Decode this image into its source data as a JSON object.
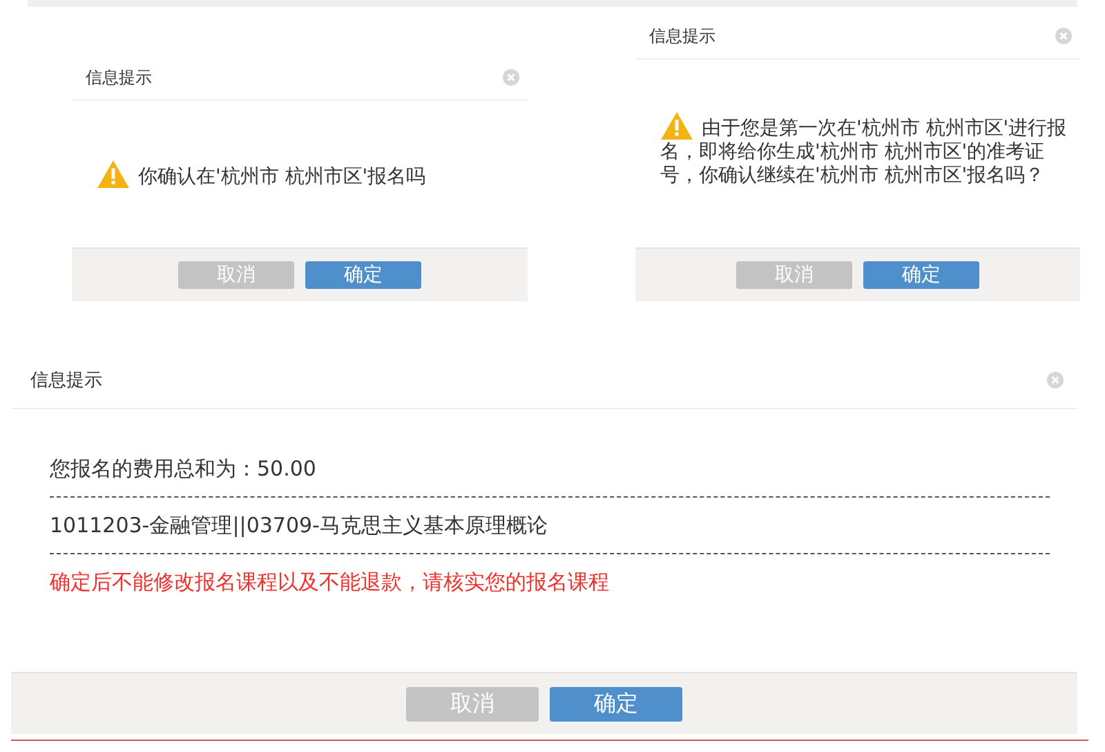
{
  "dialogs": [
    {
      "kind": "warning",
      "title": "信息提示",
      "message": "你确认在'杭州市 杭州市区'报名吗",
      "buttons": [
        {
          "kind": "cancel",
          "label": "取消"
        },
        {
          "kind": "confirm",
          "label": "确定"
        }
      ]
    },
    {
      "kind": "warning",
      "title": "信息提示",
      "message": "由于您是第一次在'杭州市 杭州市区'进行报名，即将给你生成'杭州市 杭州市区'的准考证号，你确认继续在'杭州市 杭州市区'报名吗？",
      "buttons": [
        {
          "kind": "cancel",
          "label": "取消"
        },
        {
          "kind": "confirm",
          "label": "确定"
        }
      ]
    },
    {
      "kind": "summary",
      "title": "信息提示",
      "lines": [
        {
          "kind": "plain",
          "text": "您报名的费用总和为：50.00"
        },
        {
          "kind": "plain",
          "text": "1011203-金融管理||03709-马克思主义基本原理概论"
        },
        {
          "kind": "alert",
          "text": "确定后不能修改报名课程以及不能退款，请核实您的报名课程"
        }
      ],
      "buttons": [
        {
          "kind": "cancel",
          "label": "取消"
        },
        {
          "kind": "confirm",
          "label": "确定"
        }
      ]
    }
  ]
}
